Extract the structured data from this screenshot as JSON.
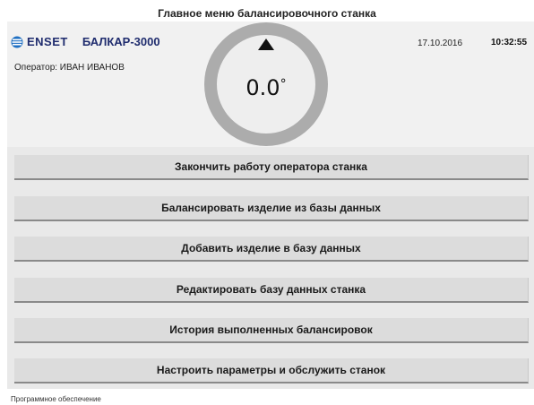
{
  "window": {
    "title": "Главное меню балансировочного станка"
  },
  "header": {
    "brand": "ENSET",
    "model": "БАЛКАР-3000",
    "operator": "Оператор: ИВАН ИВАНОВ",
    "date": "17.10.2016",
    "time": "10:32:55",
    "logo_icon": "enset-logo-icon",
    "brand_color": "#1f2c6e"
  },
  "gauge": {
    "value": "0.0",
    "unit": "°",
    "pointer_icon": "triangle-up-icon"
  },
  "menu": {
    "items": [
      {
        "label": "Закончить работу оператора станка"
      },
      {
        "label": "Балансировать изделие из базы данных"
      },
      {
        "label": "Добавить изделие в базу данных"
      },
      {
        "label": "Редактировать базу данных станка"
      },
      {
        "label": "История выполненных балансировок"
      },
      {
        "label": "Настроить параметры и обслужить станок"
      }
    ]
  },
  "footer": {
    "text": "Программное обеспечение"
  }
}
